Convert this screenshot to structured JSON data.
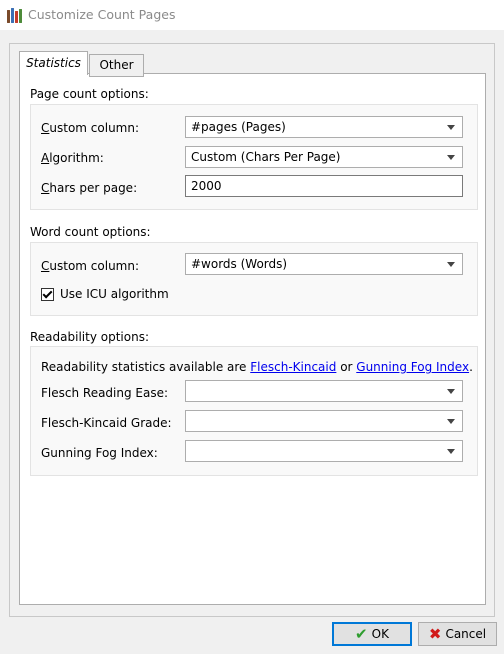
{
  "window": {
    "title": "Customize Count Pages",
    "app_icon": "books-icon"
  },
  "tabs": [
    {
      "label": "Statistics",
      "active": true
    },
    {
      "label": "Other",
      "active": false
    }
  ],
  "page_count": {
    "section_label": "Page count options:",
    "custom_column_label": "Custom column:",
    "custom_column_value": "#pages (Pages)",
    "algorithm_label": "Algorithm:",
    "algorithm_value": "Custom (Chars Per Page)",
    "chars_per_page_label": "Chars per page:",
    "chars_per_page_value": "2000"
  },
  "word_count": {
    "section_label": "Word count options:",
    "custom_column_label": "Custom column:",
    "custom_column_value": "#words (Words)",
    "icu_label": "Use ICU algorithm",
    "icu_checked": true
  },
  "readability": {
    "section_label": "Readability options:",
    "info_prefix": "Readability statistics available are ",
    "link_flesch_kincaid": "Flesch-Kincaid",
    "info_or": " or ",
    "link_gunning_fog": "Gunning Fog Index",
    "info_suffix": ".",
    "flesch_reading_ease_label": "Flesch Reading Ease:",
    "flesch_reading_ease_value": "",
    "flesch_kincaid_grade_label": "Flesch-Kincaid Grade:",
    "flesch_kincaid_grade_value": "",
    "gunning_fog_label": "Gunning Fog Index:",
    "gunning_fog_value": ""
  },
  "buttons": {
    "ok_label": "OK",
    "cancel_label": "Cancel"
  }
}
